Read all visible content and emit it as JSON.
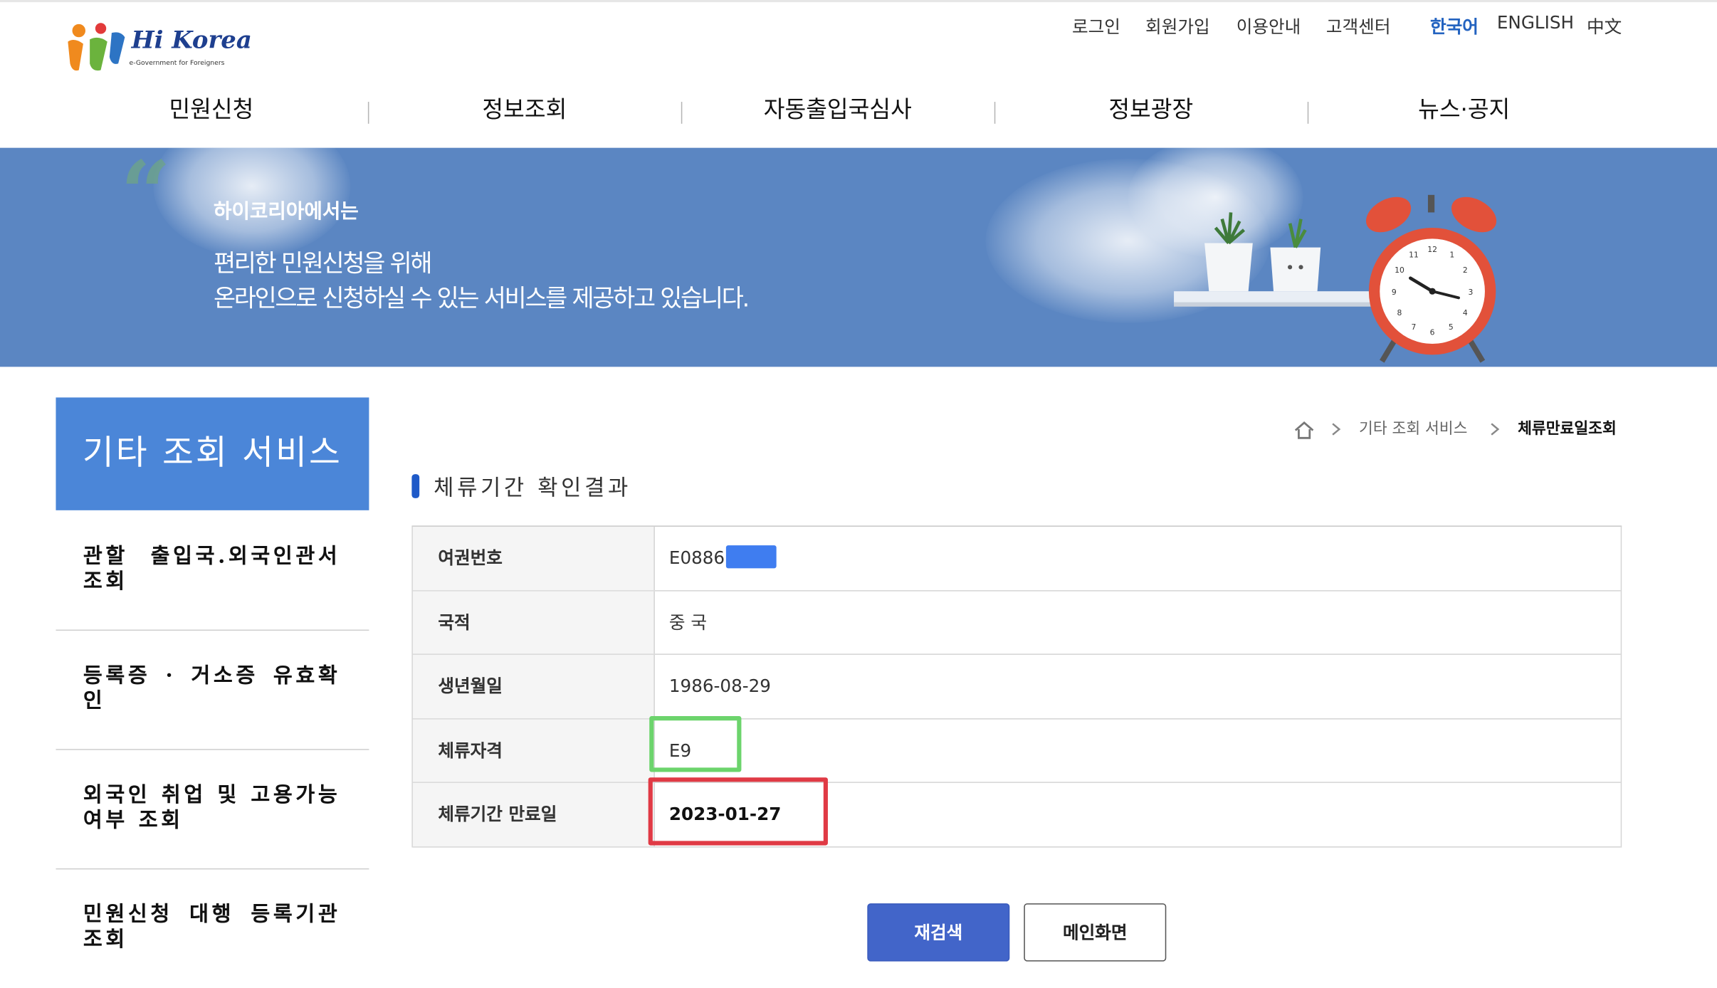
{
  "header": {
    "logo": {
      "name": "Hi Korea",
      "tagline": "e-Government for Foreigners"
    },
    "utility_links": [
      "로그인",
      "회원가입",
      "이용안내",
      "고객센터"
    ],
    "languages": [
      "한국어",
      "ENGLISH",
      "中文"
    ],
    "active_language": "한국어",
    "nav": [
      "민원신청",
      "정보조회",
      "자동출입국심사",
      "정보광장",
      "뉴스·공지"
    ]
  },
  "banner": {
    "small_title": "하이코리아에서는",
    "line1": "편리한 민원신청을 위해",
    "line2": "온라인으로 신청하실 수 있는 서비스를 제공하고 있습니다.",
    "clock_numbers": [
      "12",
      "1",
      "2",
      "3",
      "4",
      "5",
      "6",
      "7",
      "8",
      "9",
      "10",
      "11"
    ]
  },
  "sidebar": {
    "title": "기타 조회 서비스",
    "items": [
      "관할 출입국.외국인관서 조회",
      "등록증 · 거소증 유효확인",
      "외국인 취업 및 고용가능여부 조회",
      "민원신청 대행 등록기관 조회"
    ]
  },
  "breadcrumb": [
    "기타 조회 서비스",
    "체류만료일조회"
  ],
  "section_title": "체류기간 확인결과",
  "result_table": [
    {
      "label": "여권번호",
      "value": "E0886"
    },
    {
      "label": "국적",
      "value": "중 국"
    },
    {
      "label": "생년월일",
      "value": "1986-08-29"
    },
    {
      "label": "체류자격",
      "value": "E9"
    },
    {
      "label": "체류기간 만료일",
      "value": "2023-01-27"
    }
  ],
  "buttons": {
    "research": "재검색",
    "main": "메인화면"
  },
  "colors": {
    "brand_blue": "#4b86d8",
    "banner_blue": "#5b86c2",
    "primary_button": "#4265c9",
    "highlight_green": "#6cd46c",
    "highlight_red": "#e03a45",
    "redaction": "#3f7df0"
  }
}
